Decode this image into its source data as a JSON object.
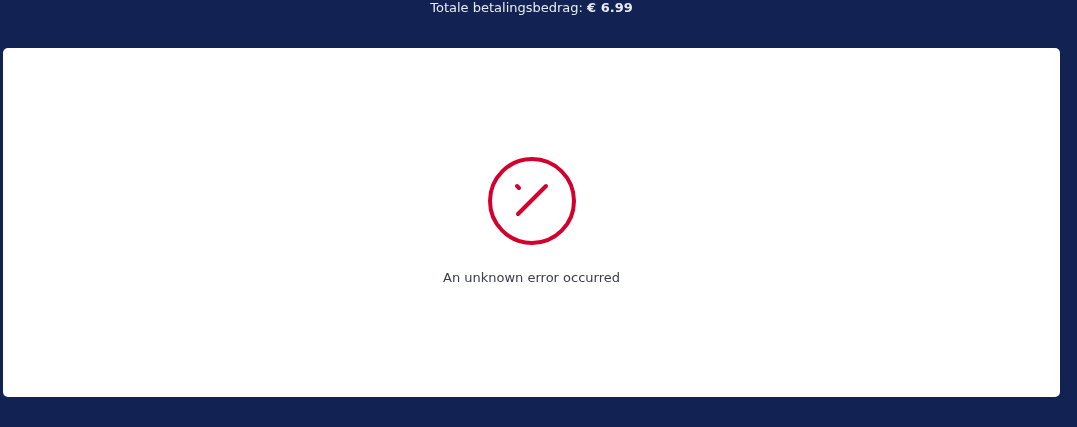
{
  "header": {
    "total_text": "Totale betalingsbedrag: **€ 6.99**"
  },
  "error_panel": {
    "message": "An unknown error occurred"
  }
}
